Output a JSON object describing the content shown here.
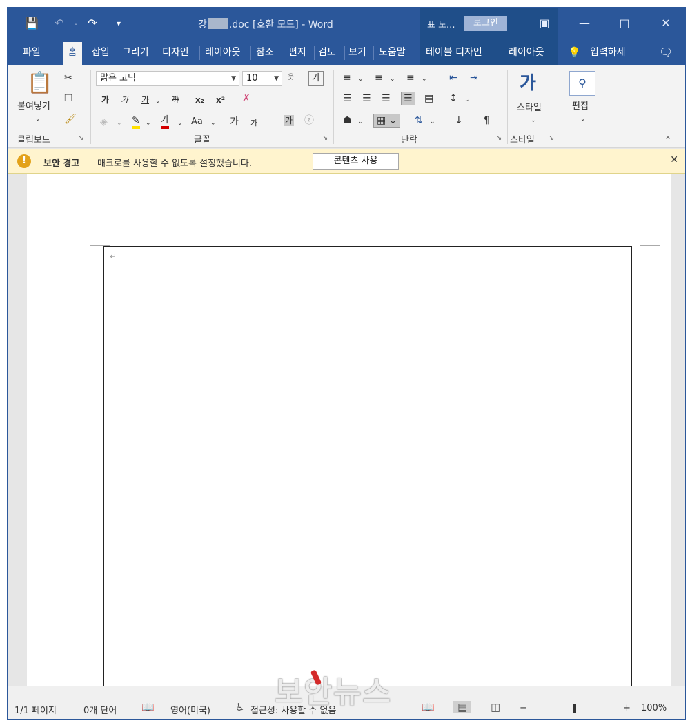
{
  "titlebar": {
    "title_prefix": "강",
    "title_suffix": ".doc [호환 모드]  -  Word",
    "context_label": "표 도...",
    "login_label": "로그인"
  },
  "tabs": [
    {
      "label": "파일"
    },
    {
      "label": "홈"
    },
    {
      "label": "삽입"
    },
    {
      "label": "그리기"
    },
    {
      "label": "디자인"
    },
    {
      "label": "레이아웃"
    },
    {
      "label": "참조"
    },
    {
      "label": "편지"
    },
    {
      "label": "검토"
    },
    {
      "label": "보기"
    },
    {
      "label": "도움말"
    },
    {
      "label": "테이블 디자인"
    },
    {
      "label": "레이아웃"
    },
    {
      "label": "입력하세"
    }
  ],
  "ribbon": {
    "clipboard": {
      "paste_label": "붙여넣기",
      "group_label": "클립보드"
    },
    "font": {
      "font_name": "맑은 고딕",
      "font_size": "10",
      "group_label": "글꼴",
      "bold": "가",
      "italic": "가",
      "underline": "가",
      "strike": "꺄",
      "subscript": "x₂",
      "superscript": "x²",
      "case": "Aa",
      "grow": "가",
      "shrink": "가"
    },
    "paragraph": {
      "group_label": "단락"
    },
    "styles": {
      "style_label": "스타일",
      "group_label": "스타일"
    },
    "editing": {
      "edit_label": "편집"
    }
  },
  "message_bar": {
    "title": "보안 경고",
    "text": "매크로를 사용할 수 없도록 설정했습니다.",
    "button_label": "콘텐츠 사용"
  },
  "statusbar": {
    "page": "1/1 페이지",
    "words": "0개 단어",
    "language": "영어(미국)",
    "accessibility": "접근성: 사용할 수 없음",
    "zoom_minus": "−",
    "zoom_plus": "+",
    "zoom": "100%"
  },
  "watermark": "보안뉴스",
  "colors": {
    "titlebar": "#2b579a",
    "context_tab": "#1f4e89",
    "ribbon": "#f3f3f3",
    "message_bar": "#fff4ce"
  }
}
